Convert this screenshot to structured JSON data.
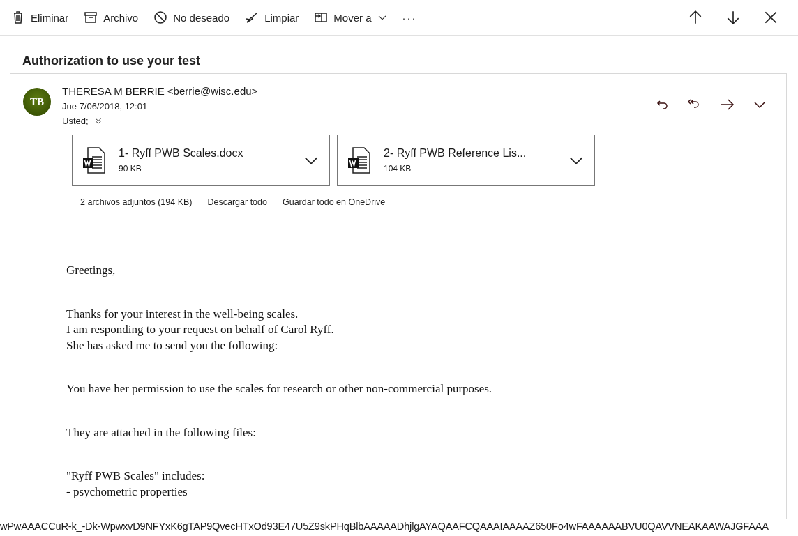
{
  "toolbar": {
    "actions": [
      {
        "kind": "trash",
        "label": "Eliminar"
      },
      {
        "kind": "archive",
        "label": "Archivo"
      },
      {
        "kind": "block",
        "label": "No deseado"
      },
      {
        "kind": "sweep",
        "label": "Limpiar"
      },
      {
        "kind": "move",
        "label": "Mover a",
        "dropdown": true
      }
    ],
    "more": "···",
    "nav": [
      {
        "kind": "up"
      },
      {
        "kind": "down"
      },
      {
        "kind": "close"
      }
    ]
  },
  "subject": "Authorization to use your test",
  "message": {
    "avatar": "TB",
    "sender": "THERESA M BERRIE <berrie@wisc.edu>",
    "date": "Jue 7/06/2018, 12:01",
    "to": "Usted;",
    "actions": [
      {
        "kind": "reply"
      },
      {
        "kind": "reply-all"
      },
      {
        "kind": "forward"
      },
      {
        "kind": "more"
      }
    ],
    "attachments": [
      {
        "name": "1- Ryff PWB Scales.docx",
        "size": "90 KB"
      },
      {
        "name": "2- Ryff PWB Reference Lis...",
        "size": "104 KB"
      }
    ],
    "attachment_summary": "2 archivos adjuntos (194 KB)",
    "attachment_links": [
      "Descargar todo",
      "Guardar todo en OneDrive"
    ],
    "body": [
      [
        "Greetings,"
      ],
      [
        "Thanks for your interest in the well-being scales.",
        "I am responding to your request on behalf of Carol Ryff.",
        "She has asked me to send you the following:"
      ],
      [
        "You have her permission to use the scales for research or other non-commercial purposes."
      ],
      [
        "They are attached in the following files:"
      ],
      [
        "\"Ryff PWB Scales\" includes:",
        "- psychometric properties"
      ]
    ]
  },
  "status_bar": "wPwAAACCuR-k_-Dk-WpwxvD9NFYxK6gTAP9QvecHTxOd93E47U5Z9skPHqBlbAAAAADhjlgAYAQAAFCQAAAIAAAAZ650Fo4wFAAAAAABVU0QAVVNEAKAAWAJGFAAA"
}
